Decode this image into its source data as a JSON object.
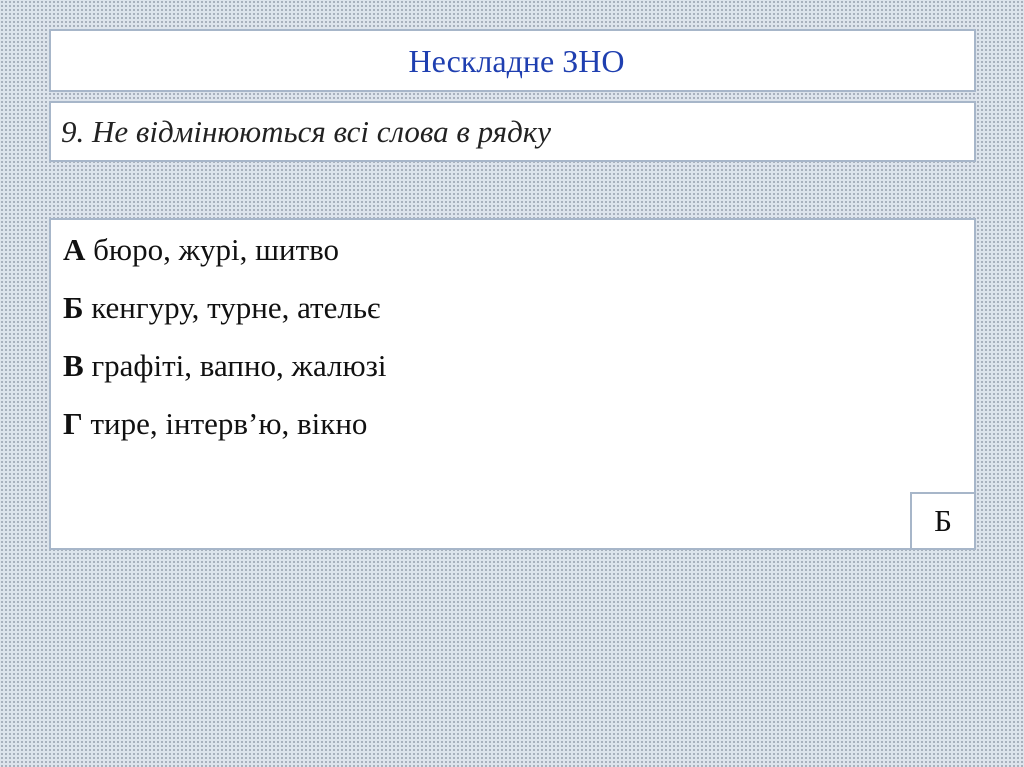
{
  "slide": {
    "title": "Нескладне ЗНО",
    "question": "9.  Не відмінюються всі слова в рядку",
    "options": [
      {
        "letter": "А",
        "text": " бюро, журі, шитво"
      },
      {
        "letter": "Б",
        "text": " кенгуру, турне, ательє"
      },
      {
        "letter": "В",
        "text": " графіті, вапно, жалюзі"
      },
      {
        "letter": "Г",
        "text": " тире, інтерв’ю, вікно"
      }
    ],
    "answer": "Б"
  },
  "colors": {
    "title": "#1f3fb0",
    "border": "#a7b6c9",
    "background": "#dde4ec"
  }
}
